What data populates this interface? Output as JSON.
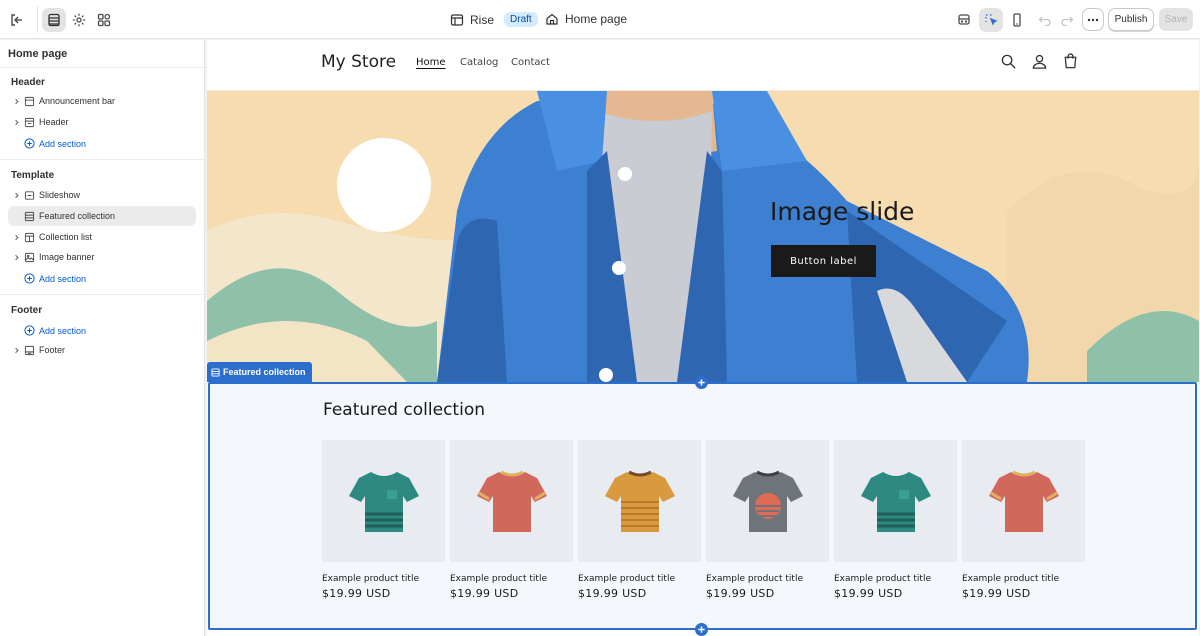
{
  "topbar": {
    "theme_name": "Rise",
    "theme_status": "Draft",
    "current_page": "Home page",
    "publish_label": "Publish",
    "save_label": "Save"
  },
  "sidebar": {
    "title": "Home page",
    "groups": [
      {
        "title": "Header",
        "items": [
          "Announcement bar",
          "Header"
        ],
        "add_label": "Add section"
      },
      {
        "title": "Template",
        "items": [
          "Slideshow",
          "Featured collection",
          "Collection list",
          "Image banner"
        ],
        "add_label": "Add section"
      },
      {
        "title": "Footer",
        "add_label": "Add section",
        "items": [
          "Footer"
        ]
      }
    ],
    "selected_item": "Featured collection"
  },
  "store": {
    "name": "My Store",
    "nav": [
      "Home",
      "Catalog",
      "Contact"
    ],
    "active_nav": "Home"
  },
  "hero": {
    "title": "Image slide",
    "button_label": "Button label"
  },
  "featured": {
    "tag_label": "Featured collection",
    "title": "Featured collection",
    "products": [
      {
        "title": "Example product title",
        "price": "$19.99 USD",
        "color": "#2e8a80"
      },
      {
        "title": "Example product title",
        "price": "$19.99 USD",
        "color": "#d0685c"
      },
      {
        "title": "Example product title",
        "price": "$19.99 USD",
        "color": "#d99a3f"
      },
      {
        "title": "Example product title",
        "price": "$19.99 USD",
        "color": "#6e7479"
      },
      {
        "title": "Example product title",
        "price": "$19.99 USD",
        "color": "#2e8a80"
      },
      {
        "title": "Example product title",
        "price": "$19.99 USD",
        "color": "#d0685c"
      }
    ]
  },
  "colors": {
    "accent": "#2c6ecb",
    "link": "#005bd3",
    "hero_background": "#f7dcb0"
  }
}
